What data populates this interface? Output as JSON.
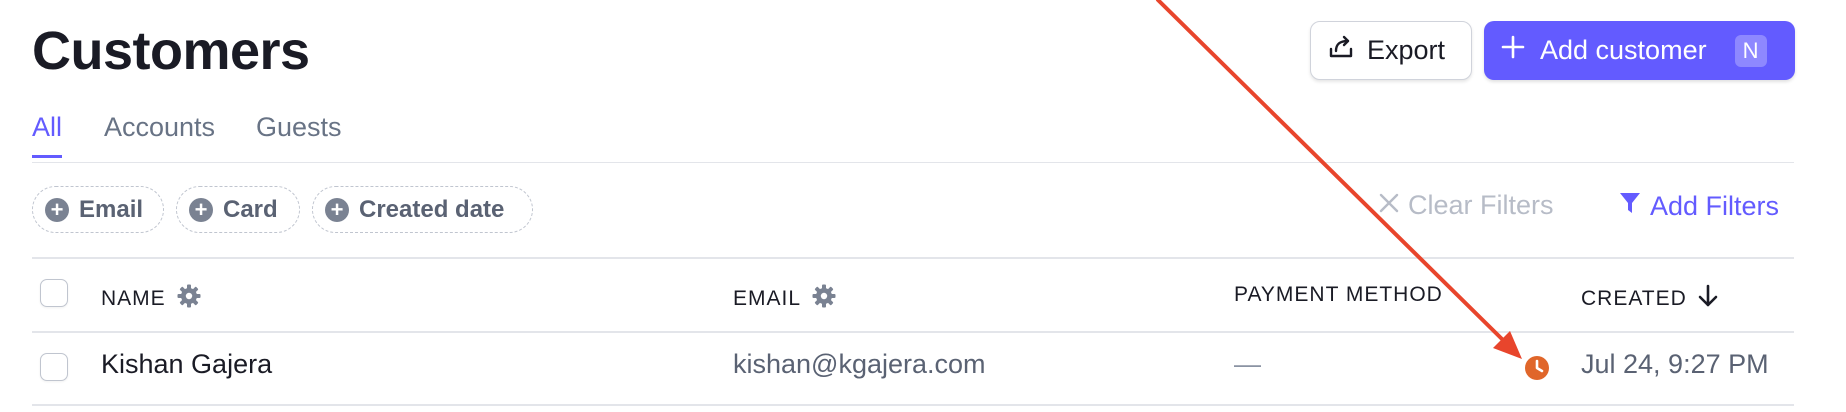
{
  "header": {
    "title": "Customers",
    "export_label": "Export",
    "add_customer_label": "Add customer",
    "add_customer_shortcut": "N"
  },
  "tabs": [
    {
      "label": "All",
      "active": true
    },
    {
      "label": "Accounts",
      "active": false
    },
    {
      "label": "Guests",
      "active": false
    }
  ],
  "filters": {
    "chips": [
      {
        "label": "Email"
      },
      {
        "label": "Card"
      },
      {
        "label": "Created date"
      }
    ],
    "clear_label": "Clear Filters",
    "add_label": "Add Filters"
  },
  "table": {
    "columns": [
      {
        "label": "NAME",
        "icon": "gear-icon"
      },
      {
        "label": "EMAIL",
        "icon": "gear-icon"
      },
      {
        "label": "PAYMENT METHOD"
      },
      {
        "label": "CREATED",
        "icon": "arrow-down-icon"
      }
    ],
    "rows": [
      {
        "name": "Kishan Gajera",
        "email": "kishan@kgajera.com",
        "payment_method": "—",
        "status_icon": "clock-icon",
        "created": "Jul 24, 9:27 PM"
      }
    ]
  },
  "colors": {
    "accent": "#635bff",
    "annotation_arrow": "#e8452c",
    "clock": "#e0662a"
  }
}
